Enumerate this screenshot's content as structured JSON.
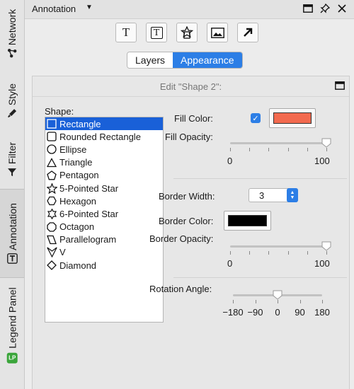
{
  "side_tabs": {
    "network": "Network",
    "style": "Style",
    "filter": "Filter",
    "annotation": "Annotation",
    "legend_panel": "Legend Panel",
    "legend_icon_text": "LP"
  },
  "header": {
    "title": "Annotation"
  },
  "toolbar": {
    "items": [
      "add-text",
      "add-bounded-text",
      "add-shape",
      "add-image",
      "add-arrow"
    ],
    "text_glyph": "T"
  },
  "tabs": {
    "layers": "Layers",
    "appearance": "Appearance",
    "active": "Appearance"
  },
  "edit_panel": {
    "title": "Edit \"Shape 2\":",
    "shape_label": "Shape:",
    "shapes": [
      "Rectangle",
      "Rounded Rectangle",
      "Ellipse",
      "Triangle",
      "Pentagon",
      "5-Pointed Star",
      "Hexagon",
      "6-Pointed Star",
      "Octagon",
      "Parallelogram",
      "V",
      "Diamond"
    ],
    "selected_shape": "Rectangle",
    "fill_color_label": "Fill Color:",
    "fill_color_checked": true,
    "fill_color": "#f26a4f",
    "fill_opacity_label": "Fill Opacity:",
    "fill_opacity": {
      "value": 100,
      "min_label": "0",
      "max_label": "100"
    },
    "border_width_label": "Border Width:",
    "border_width": "3",
    "border_color_label": "Border Color:",
    "border_color": "#000000",
    "border_opacity_label": "Border Opacity:",
    "border_opacity": {
      "value": 100,
      "min_label": "0",
      "max_label": "100"
    },
    "rotation_label": "Rotation Angle:",
    "rotation": {
      "value": 0,
      "ticks": [
        "−180",
        "−90",
        "0",
        "90",
        "180"
      ]
    }
  },
  "colors": {
    "accent": "#2c7ee6",
    "selection": "#1960d8"
  }
}
